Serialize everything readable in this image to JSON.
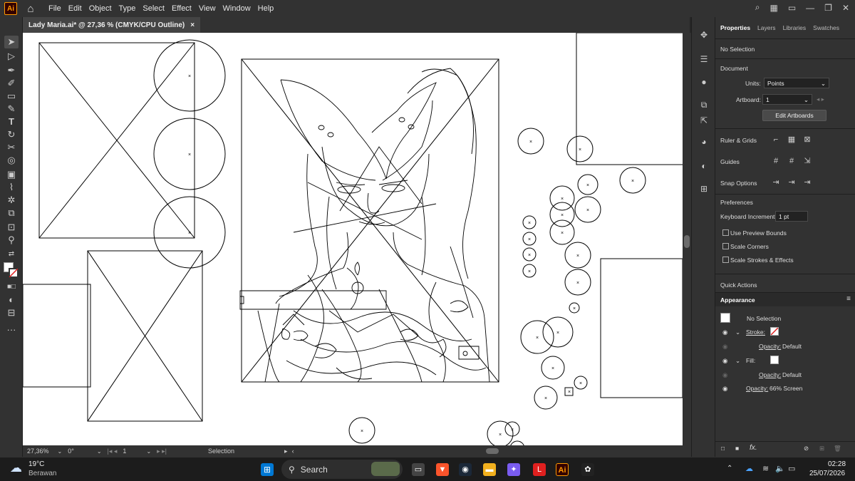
{
  "app": {
    "logo": "Ai",
    "home_icon": "home-icon"
  },
  "menu": [
    "File",
    "Edit",
    "Object",
    "Type",
    "Select",
    "Effect",
    "View",
    "Window",
    "Help"
  ],
  "document_tab": {
    "title": "Lady Maria.ai* @ 27,36 % (CMYK/CPU Outline)",
    "close": "×"
  },
  "status_bar": {
    "zoom": "27,36%",
    "rotation": "0°",
    "artboard": "1",
    "tool": "Selection"
  },
  "panel": {
    "tabs": [
      "Properties",
      "Layers",
      "Libraries",
      "Swatches"
    ],
    "selection": "No Selection",
    "document_heading": "Document",
    "units_label": "Units:",
    "units_value": "Points",
    "artboard_label": "Artboard:",
    "artboard_value": "1",
    "edit_artboards": "Edit Artboards",
    "ruler_grids": "Ruler & Grids",
    "guides": "Guides",
    "snap_options": "Snap Options",
    "preferences": "Preferences",
    "keyboard_increment_label": "Keyboard Increment:",
    "keyboard_increment_value": "1 pt",
    "use_preview_bounds": "Use Preview Bounds",
    "scale_corners": "Scale Corners",
    "scale_strokes": "Scale Strokes & Effects",
    "quick_actions": "Quick Actions"
  },
  "appearance": {
    "heading": "Appearance",
    "selection": "No Selection",
    "stroke_label": "Stroke:",
    "opacity_label": "Opacity:",
    "opacity_value": "Default",
    "fill_label": "Fill:",
    "opacity2_label": "Opacity:",
    "opacity2_value": "Default",
    "opacity3_label": "Opacity:",
    "opacity3_value": "66% Screen",
    "fx": "fx."
  },
  "taskbar": {
    "weather_temp": "19°C",
    "weather_desc": "Berawan",
    "search_placeholder": "Search",
    "time": "02:28",
    "date": "25/07/2026"
  }
}
